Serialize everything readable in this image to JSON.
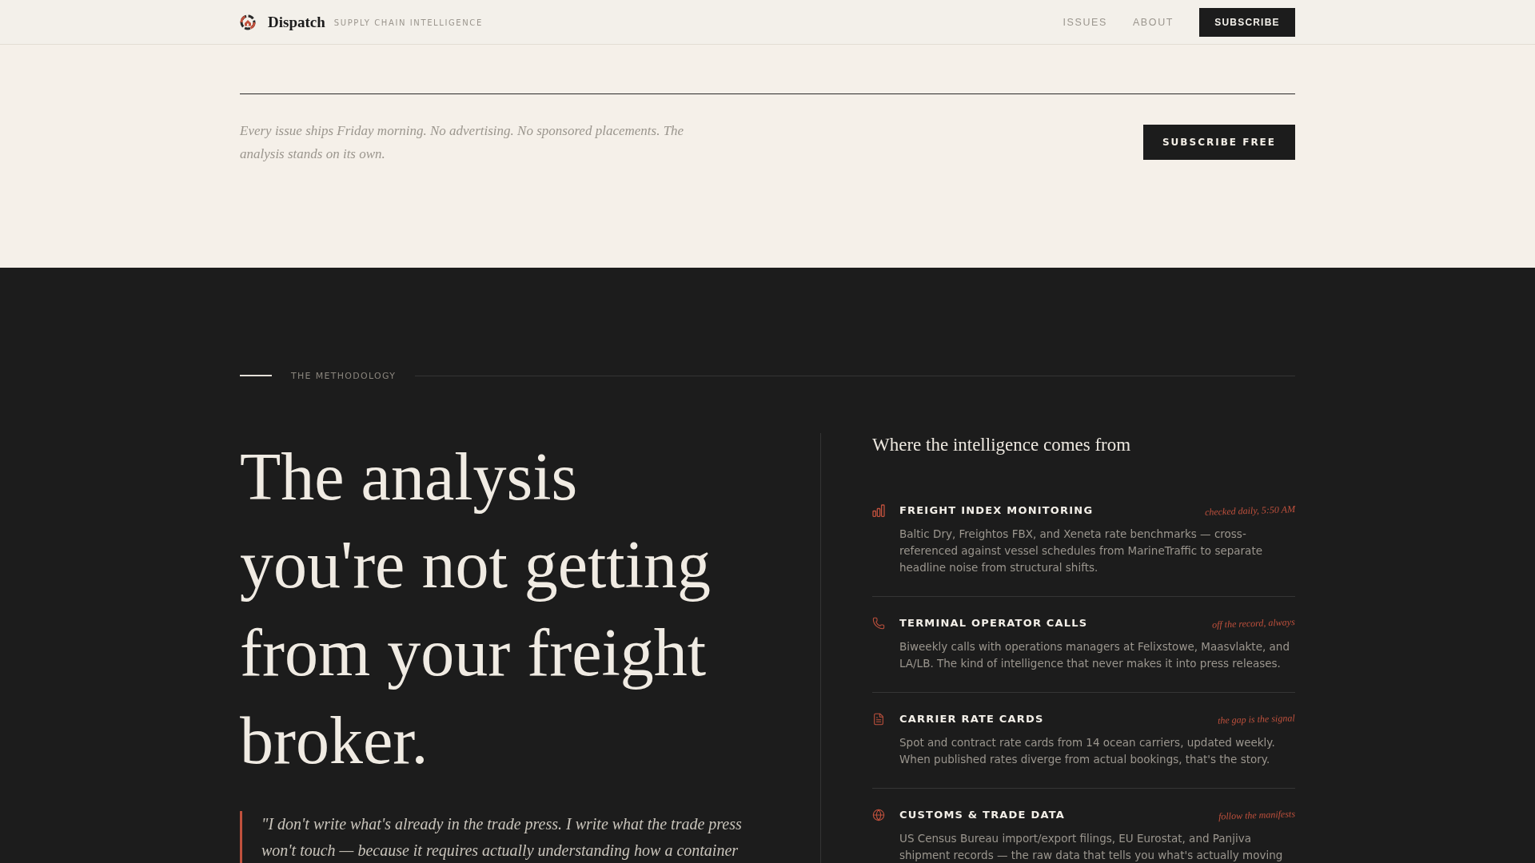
{
  "header": {
    "brand": "Dispatch",
    "tagline": "SUPPLY CHAIN INTELLIGENCE",
    "nav": [
      {
        "label": "ISSUES"
      },
      {
        "label": "ABOUT"
      }
    ],
    "cta": "SUBSCRIBE"
  },
  "subscribe_strip": {
    "text": "Every issue ships Friday morning. No advertising. No sponsored placements. The analysis stands on its own.",
    "button": "SUBSCRIBE FREE"
  },
  "methodology": {
    "eyebrow": "THE METHODOLOGY",
    "headline": "The analysis you're not getting from your freight broker.",
    "quote": "\"I don't write what's already in the trade press. I write what the trade press won't touch — because it requires actually understanding how a container",
    "sources_title": "Where the intelligence comes from",
    "sources": [
      {
        "kind": "index",
        "title": "FREIGHT INDEX MONITORING",
        "note": "checked daily, 5:50 AM",
        "description": "Baltic Dry, Freightos FBX, and Xeneta rate benchmarks — cross-referenced against vessel schedules from MarineTraffic to separate headline noise from structural shifts."
      },
      {
        "kind": "calls",
        "title": "TERMINAL OPERATOR CALLS",
        "note": "off the record, always",
        "description": "Biweekly calls with operations managers at Felixstowe, Maasvlakte, and LA/LB. The kind of intelligence that never makes it into press releases."
      },
      {
        "kind": "cards",
        "title": "CARRIER RATE CARDS",
        "note": "the gap is the signal",
        "description": "Spot and contract rate cards from 14 ocean carriers, updated weekly. When published rates diverge from actual bookings, that's the story."
      },
      {
        "kind": "customs",
        "title": "CUSTOMS & TRADE DATA",
        "note": "follow the manifests",
        "description": "US Census Bureau import/export filings, EU Eurostat, and Panjiva shipment records — the raw data that tells you what's actually moving"
      }
    ]
  }
}
